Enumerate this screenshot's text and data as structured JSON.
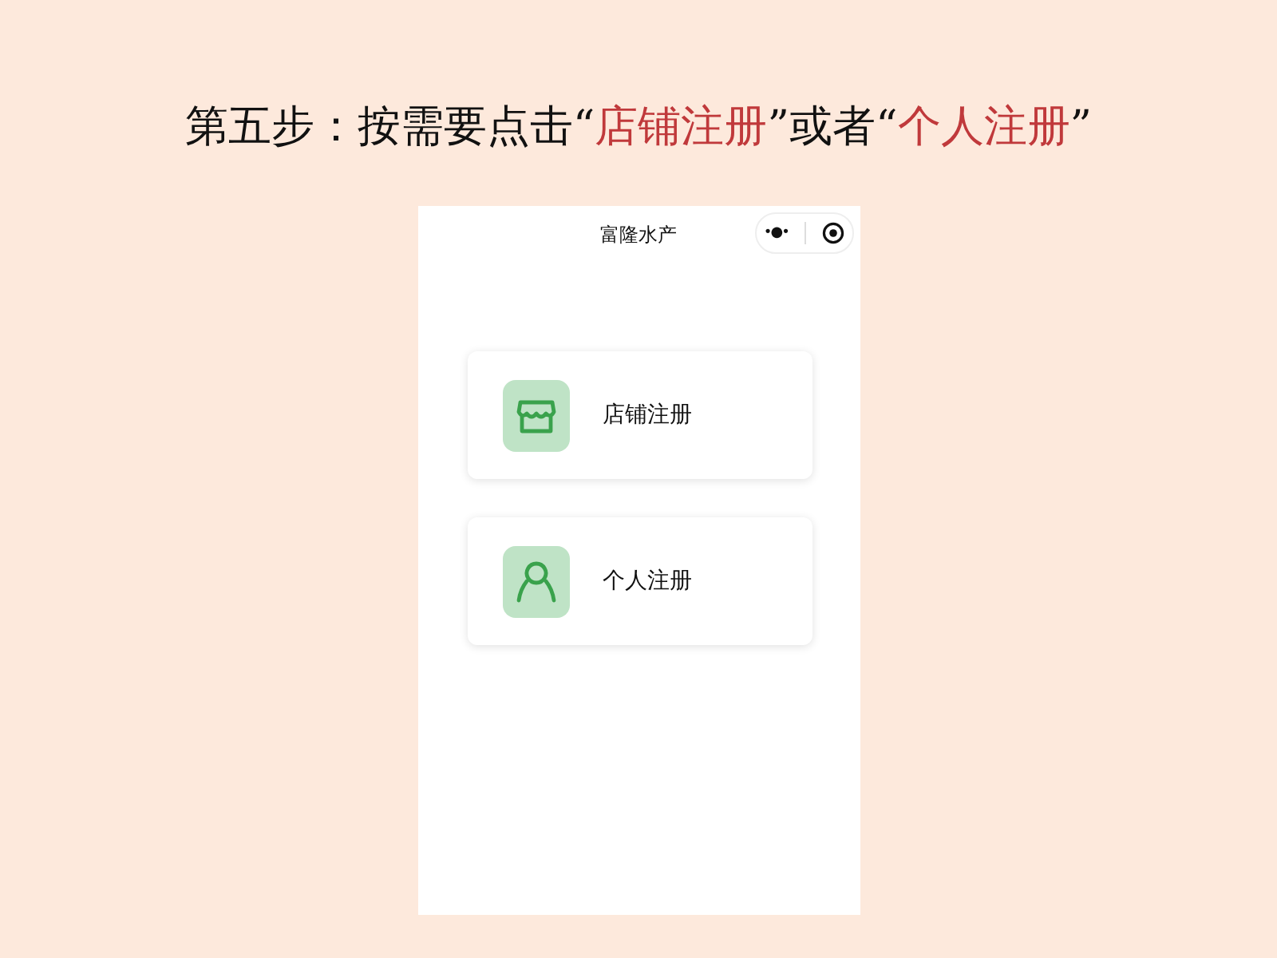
{
  "slide_title": [
    {
      "text": "第五步：按需要点击“",
      "highlight": false
    },
    {
      "text": "店铺注册",
      "highlight": true
    },
    {
      "text": "”或者“",
      "highlight": false
    },
    {
      "text": "个人注册",
      "highlight": true
    },
    {
      "text": "”",
      "highlight": false
    }
  ],
  "phone": {
    "title": "富隆水产",
    "menu_glyph": "•●•",
    "cards": [
      {
        "kind": "shop",
        "label": "店铺注册"
      },
      {
        "kind": "person",
        "label": "个人注册"
      }
    ]
  }
}
